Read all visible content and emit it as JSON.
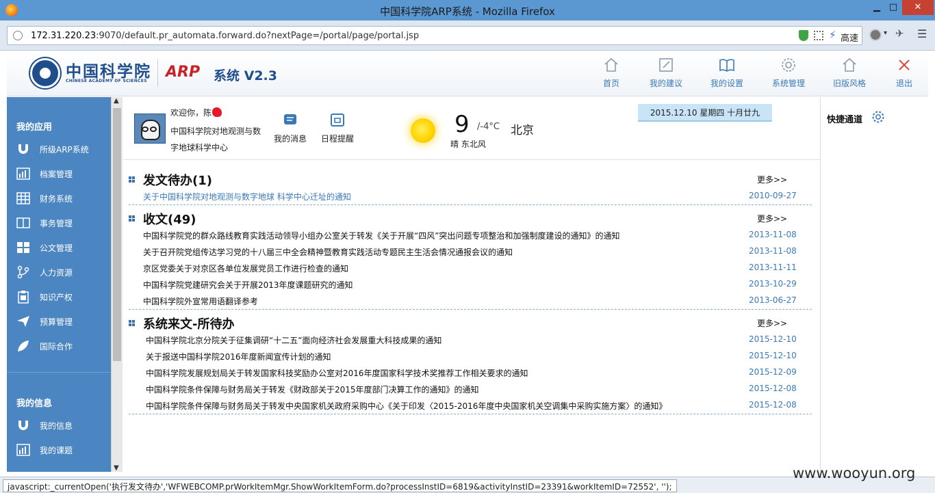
{
  "browser": {
    "window_title": "中国科学院ARP系统 - Mozilla Firefox",
    "url_host": "172.31.220.23",
    "url_rest": ":9070/default.pr_automata.forward.do?nextPage=/portal/page/portal.jsp",
    "speed_label": "高速",
    "status_text": "javascript:_currentOpen('执行发文待办','WFWEBCOMP.prWorkItemMgr.ShowWorkItemForm.do?processInstID=6819&activityInstID=23391&workItemID=72552', '');"
  },
  "header": {
    "logo_cn": "中国科学院",
    "logo_en": "CHINESE ACADEMY OF SCIENCES",
    "arp_logo": "ARP",
    "arp_system": "系统 V2.3",
    "nav": [
      {
        "label": "首页",
        "icon": "home-icon"
      },
      {
        "label": "我的建议",
        "icon": "edit-icon"
      },
      {
        "label": "我的设置",
        "icon": "book-icon"
      },
      {
        "label": "系统管理",
        "icon": "gear-icon"
      },
      {
        "label": "旧版风格",
        "icon": "home-outline-icon"
      },
      {
        "label": "退出",
        "icon": "close-x-icon"
      }
    ]
  },
  "sidebar": {
    "section1": "我的应用",
    "items": [
      {
        "label": "所级ARP系统",
        "icon": "magnet-icon"
      },
      {
        "label": "档案管理",
        "icon": "bar-chart-icon"
      },
      {
        "label": "财务系统",
        "icon": "grid-icon"
      },
      {
        "label": "事务管理",
        "icon": "book-open-icon"
      },
      {
        "label": "公文管理",
        "icon": "tiles-icon"
      },
      {
        "label": "人力资源",
        "icon": "branch-icon"
      },
      {
        "label": "知识产权",
        "icon": "clipboard-icon"
      },
      {
        "label": "预算管理",
        "icon": "paper-plane-icon"
      },
      {
        "label": "国际合作",
        "icon": "leaf-icon"
      }
    ],
    "section2": "我的信息",
    "items2": [
      {
        "label": "我的信息",
        "icon": "magnet-icon"
      },
      {
        "label": "我的课题",
        "icon": "bar-chart-icon"
      }
    ]
  },
  "user": {
    "welcome": "欢迎你，",
    "name": "陈",
    "org": "中国科学院对地观测与数字地球科学中心",
    "messages_label": "我的消息",
    "schedule_label": "日程提醒"
  },
  "weather": {
    "temp": "9",
    "range": "/-4°C",
    "city": "北京",
    "desc": "晴 东北风"
  },
  "date": "2015.12.10 星期四 十月廿九",
  "sections": [
    {
      "title": "发文待办(1)",
      "more": "更多>>",
      "rows": [
        {
          "title": "关于中国科学院对地观测与数字地球 科学中心迁址的通知",
          "date": "2010-09-27"
        }
      ]
    },
    {
      "title": "收文(49)",
      "more": "更多>>",
      "rows": [
        {
          "title": "中国科学院党的群众路线教育实践活动领导小组办公室关于转发《关于开展“四风”突出问题专项整治和加强制度建设的通知》的通知",
          "date": "2013-11-08"
        },
        {
          "title": "关于召开院党组传达学习党的十八届三中全会精神暨教育实践活动专题民主生活会情况通报会议的通知",
          "date": "2013-11-08"
        },
        {
          "title": "京区党委关于对京区各单位发展党员工作进行检查的通知",
          "date": "2013-11-11"
        },
        {
          "title": "中国科学院党建研究会关于开展2013年度课题研究的通知",
          "date": "2013-10-29"
        },
        {
          "title": "中国科学院外宣常用语翻译参考",
          "date": "2013-06-27"
        }
      ]
    },
    {
      "title": "系统来文-所待办",
      "more": "更多>>",
      "rows": [
        {
          "title": "中国科学院北京分院关于征集调研“十二五”面向经济社会发展重大科技成果的通知",
          "date": "2015-12-10"
        },
        {
          "title": "关于报送中国科学院2016年度新闻宣传计划的通知",
          "date": "2015-12-10"
        },
        {
          "title": "中国科学院发展规划局关于转发国家科技奖励办公室对2016年度国家科学技术奖推荐工作相关要求的通知",
          "date": "2015-12-09"
        },
        {
          "title": "中国科学院条件保障与财务局关于转发《财政部关于2015年度部门决算工作的通知》的通知",
          "date": "2015-12-08"
        },
        {
          "title": "中国科学院条件保障与财务局关于转发中央国家机关政府采购中心《关于印发〈2015-2016年度中央国家机关空调集中采购实施方案〉的通知》",
          "date": "2015-12-08"
        }
      ]
    }
  ],
  "right_panel": {
    "title": "快捷通道"
  },
  "watermark": "www.wooyun.org",
  "colors": {
    "sidebar": "#4c86c2",
    "accent": "#3a79b8",
    "brand_red": "#c8242b",
    "brand_blue": "#1f4e8c"
  }
}
